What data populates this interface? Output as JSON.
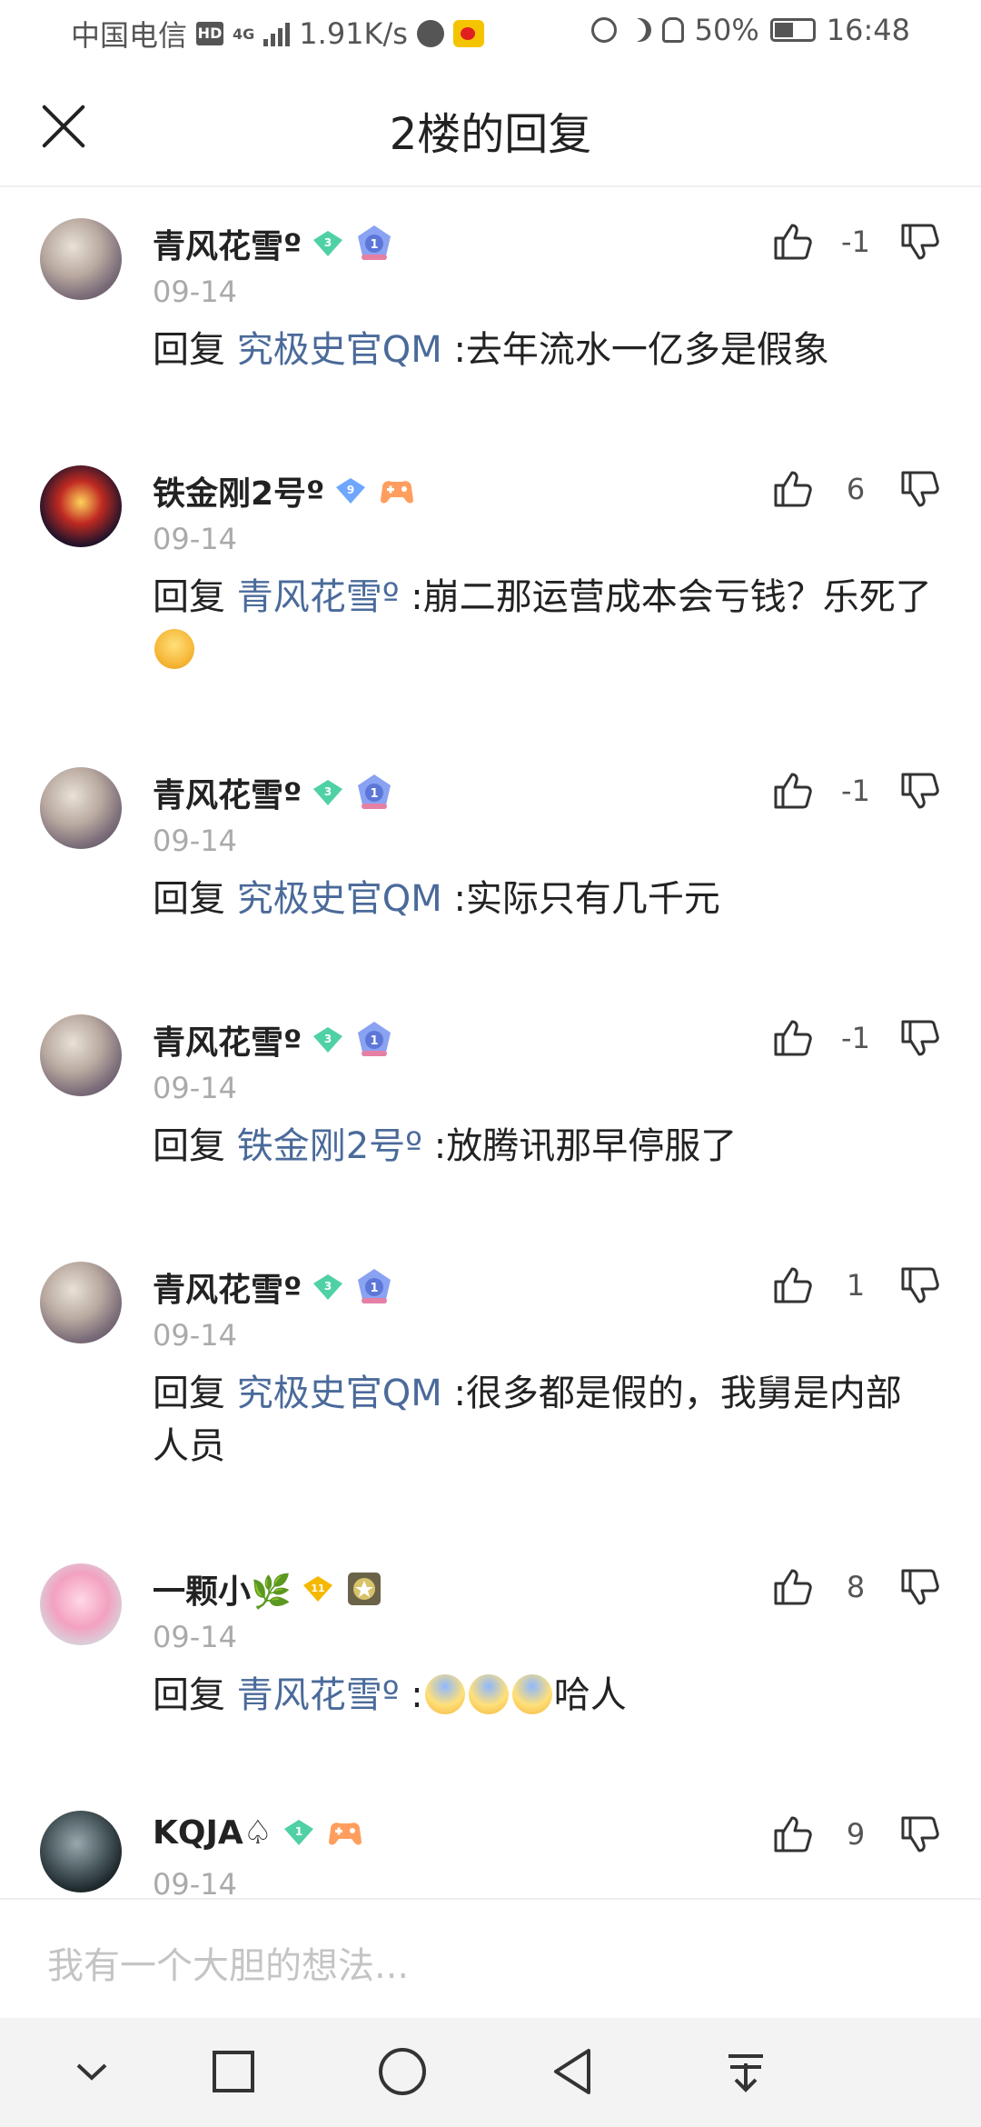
{
  "status_bar": {
    "carrier": "中国电信",
    "hd": "HD",
    "network": "4G",
    "speed": "1.91K/s",
    "battery": "50%",
    "battery_level": 0.5,
    "time": "16:48"
  },
  "header": {
    "title": "2楼的回复"
  },
  "comments": [
    {
      "username": "青风花雪º",
      "gem_level": "3",
      "gem_color": "#4fd1a5",
      "level_badge": "1",
      "date": "09-14",
      "votes": "-1",
      "reply_keyword": "回复",
      "reply_to": "究极史官QM",
      "text": " :去年流水一亿多是假象"
    },
    {
      "username": "铁金刚2号º",
      "gem_level": "9",
      "gem_color": "#6fa7ff",
      "level_badge": "game-controller",
      "date": "09-14",
      "votes": "6",
      "reply_keyword": "回复",
      "reply_to": "青风花雪º",
      "text": " :崩二那运营成本会亏钱？乐死了"
    },
    {
      "username": "青风花雪º",
      "gem_level": "3",
      "gem_color": "#4fd1a5",
      "level_badge": "1",
      "date": "09-14",
      "votes": "-1",
      "reply_keyword": "回复",
      "reply_to": "究极史官QM",
      "text": " :实际只有几千元"
    },
    {
      "username": "青风花雪º",
      "gem_level": "3",
      "gem_color": "#4fd1a5",
      "level_badge": "1",
      "date": "09-14",
      "votes": "-1",
      "reply_keyword": "回复",
      "reply_to": "铁金刚2号º",
      "text": " :放腾讯那早停服了"
    },
    {
      "username": "青风花雪º",
      "gem_level": "3",
      "gem_color": "#4fd1a5",
      "level_badge": "1",
      "date": "09-14",
      "votes": "1",
      "reply_keyword": "回复",
      "reply_to": "究极史官QM",
      "text": " :很多都是假的，我舅是内部人员"
    },
    {
      "username": "一颗小🌿",
      "gem_level": "11",
      "gem_color": "#f5b800",
      "level_badge": "star",
      "date": "09-14",
      "votes": "8",
      "reply_keyword": "回复",
      "reply_to": "青风花雪º",
      "text": " :",
      "text_after_emoji": "哈人"
    },
    {
      "username": "KQJA♤",
      "gem_level": "1",
      "gem_color": "#4fd1a5",
      "level_badge": "game-controller",
      "date": "09-14",
      "votes": "9",
      "reply_keyword": "",
      "reply_to": "",
      "text": ""
    }
  ],
  "input": {
    "placeholder": "我有一个大胆的想法..."
  },
  "icons": {
    "close": "close-icon",
    "like": "thumbs-up-icon",
    "dislike": "thumbs-down-icon",
    "nav": [
      "chevron-down-icon",
      "square-icon",
      "circle-icon",
      "back-triangle-icon",
      "download-icon"
    ]
  }
}
